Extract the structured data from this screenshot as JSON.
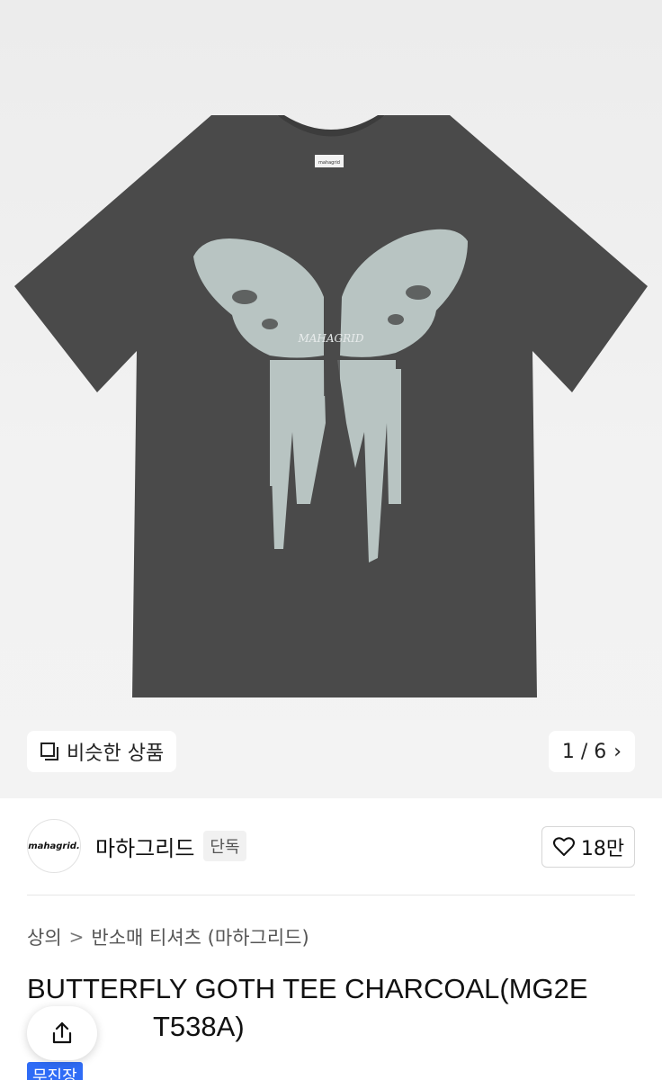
{
  "gallery": {
    "similar_label": "비슷한 상품",
    "counter": "1 / 6",
    "pager_chevron": "›",
    "shirt_label_text": "mahagrid",
    "shirt_color": "#4a4a4a",
    "print_color": "#b8c4c2"
  },
  "brand": {
    "logo_text": "mahagrid.",
    "name": "마하그리드",
    "exclusive_tag": "단독",
    "likes": "18만"
  },
  "breadcrumb": {
    "items": [
      "상의",
      "반소매 티셔츠 (마하그리드)"
    ],
    "separator": ">"
  },
  "product": {
    "title_line1": "BUTTERFLY GOTH TEE CHARCOAL(MG2E",
    "title_line2": "T538A)",
    "badge": "무진장"
  },
  "icons": {
    "similar": "similar-products-icon",
    "heart": "heart-icon",
    "share": "share-icon"
  }
}
